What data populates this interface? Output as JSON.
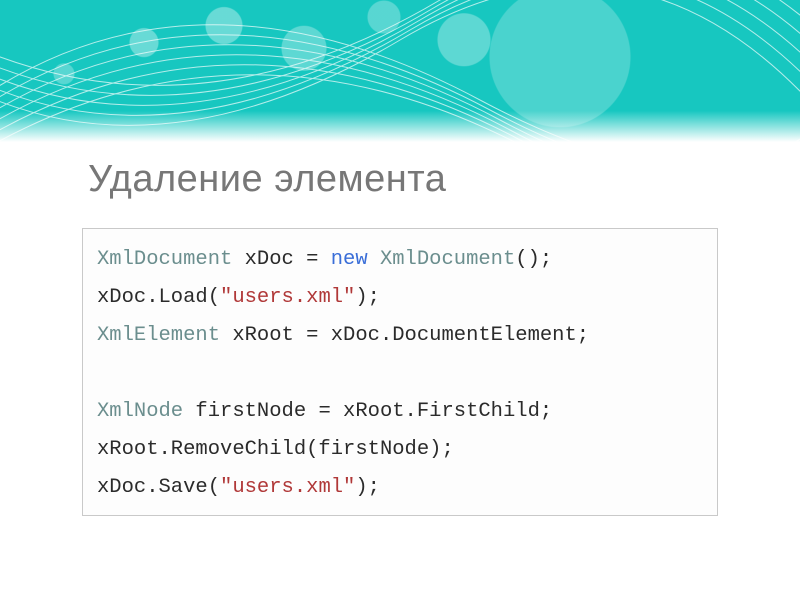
{
  "slide": {
    "title": "Удаление элемента",
    "code": {
      "line1_type": "XmlDocument",
      "line1_var": " xDoc = ",
      "line1_kw": "new",
      "line1_ctor": " XmlDocument",
      "line1_tail": "();",
      "line2_a": "xDoc.Load(",
      "line2_str": "\"users.xml\"",
      "line2_b": ");",
      "line3_type": "XmlElement",
      "line3_rest": " xRoot = xDoc.DocumentElement;",
      "blank": " ",
      "line4_type": "XmlNode",
      "line4_rest": " firstNode = xRoot.FirstChild;",
      "line5": "xRoot.RemoveChild(firstNode);",
      "line6_a": "xDoc.Save(",
      "line6_str": "\"users.xml\"",
      "line6_b": ");"
    }
  }
}
